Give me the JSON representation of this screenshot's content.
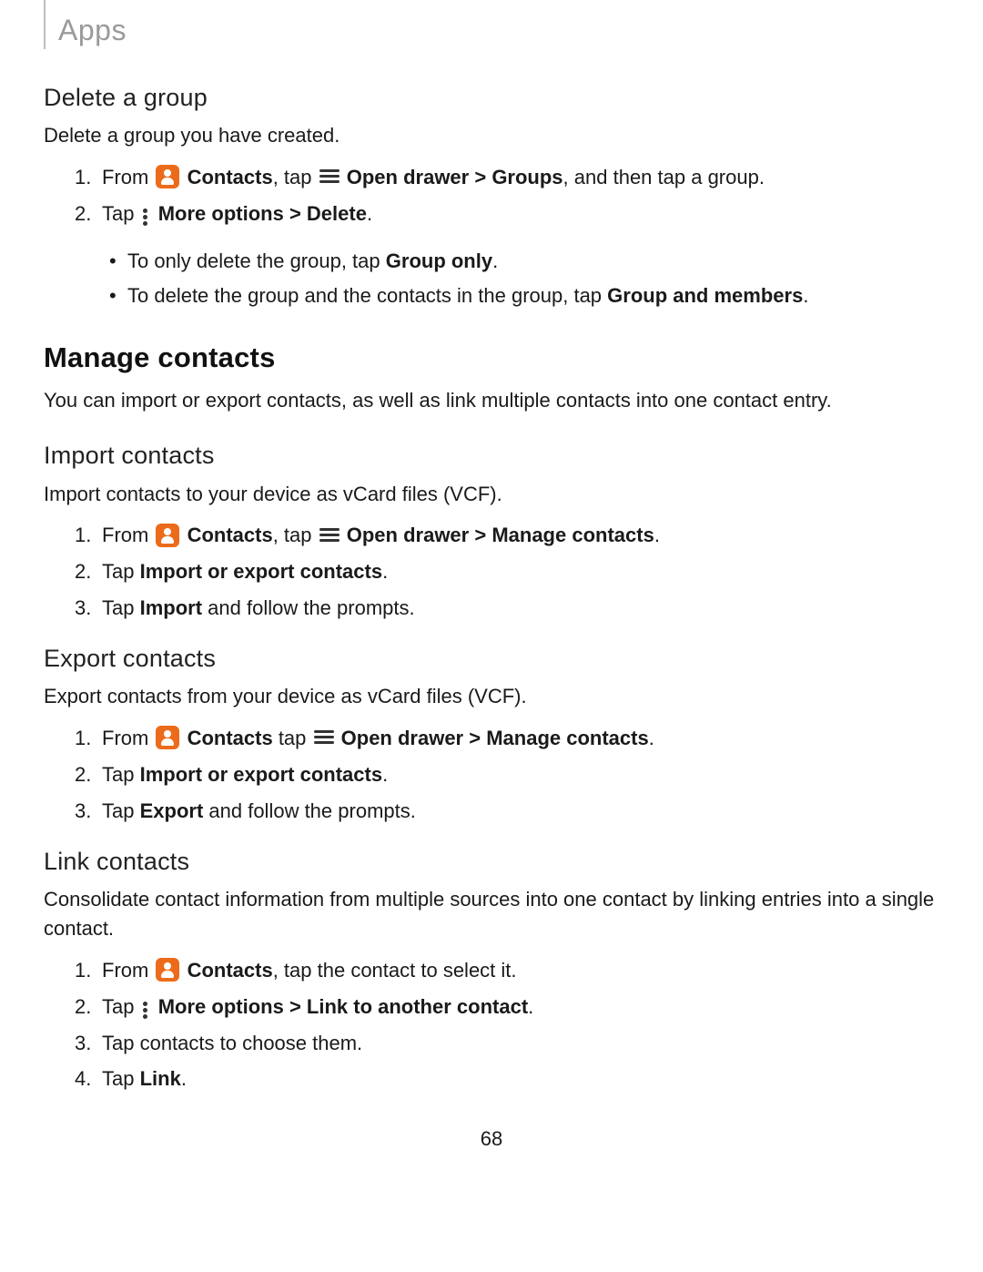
{
  "header": {
    "section_label": "Apps"
  },
  "delete_group": {
    "heading": "Delete a group",
    "intro": "Delete a group you have created.",
    "step1": {
      "pre": "From ",
      "contacts": "Contacts",
      "mid": ", tap ",
      "drawer": "Open drawer",
      "sep": " > ",
      "dest": "Groups",
      "post": ", and then tap a group."
    },
    "step2": {
      "pre": "Tap ",
      "more": "More options",
      "sep": " > ",
      "action": "Delete",
      "post": "."
    },
    "bullet1": {
      "pre": "To only delete the group, tap ",
      "b": "Group only",
      "post": "."
    },
    "bullet2": {
      "pre": "To delete the group and the contacts in the group, tap ",
      "b": "Group and members",
      "post": "."
    }
  },
  "manage": {
    "heading": "Manage contacts",
    "intro": "You can import or export contacts, as well as link multiple contacts into one contact entry."
  },
  "import": {
    "heading": "Import contacts",
    "intro": "Import contacts to your device as vCard files (VCF).",
    "step1": {
      "pre": "From ",
      "contacts": "Contacts",
      "mid": ", tap ",
      "drawer": "Open drawer",
      "sep": " > ",
      "dest": "Manage contacts",
      "post": "."
    },
    "step2": {
      "pre": "Tap ",
      "b": "Import or export contacts",
      "post": "."
    },
    "step3": {
      "pre": "Tap ",
      "b": "Import",
      "post": " and follow the prompts."
    }
  },
  "export": {
    "heading": "Export contacts",
    "intro": "Export contacts from your device as vCard files (VCF).",
    "step1": {
      "pre": "From ",
      "contacts": "Contacts",
      "mid": " tap ",
      "drawer": "Open drawer",
      "sep": " > ",
      "dest": "Manage contacts",
      "post": "."
    },
    "step2": {
      "pre": "Tap ",
      "b": "Import or export contacts",
      "post": "."
    },
    "step3": {
      "pre": "Tap ",
      "b": "Export",
      "post": " and follow the prompts."
    }
  },
  "link": {
    "heading": "Link contacts",
    "intro": "Consolidate contact information from multiple sources into one contact by linking entries into a single contact.",
    "step1": {
      "pre": "From ",
      "contacts": "Contacts",
      "post": ", tap the contact to select it."
    },
    "step2": {
      "pre": "Tap ",
      "more": "More options",
      "sep": " > ",
      "action": "Link to another contact",
      "post": "."
    },
    "step3": "Tap contacts to choose them.",
    "step4": {
      "pre": "Tap ",
      "b": "Link",
      "post": "."
    }
  },
  "page_number": "68"
}
